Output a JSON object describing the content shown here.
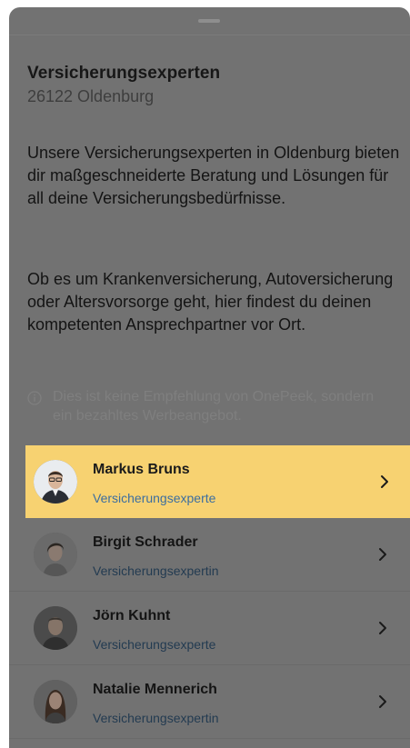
{
  "header": {
    "title": "Versicherungsexperten",
    "location": "26122 Oldenburg"
  },
  "intro": {
    "paragraph1": "Unsere Versicherungsexperten in Oldenburg bieten dir maßgeschneiderte Beratung und Lösungen für all deine Versicherungsbedürfnisse.",
    "paragraph2": "Ob es um Krankenversicherung, Autoversicherung oder Altersvorsorge geht, hier findest du deinen kompetenten Ansprechpartner vor Ort."
  },
  "disclaimer": {
    "icon": "info-icon",
    "text": "Dies ist keine Empfehlung von OnePeek, sondern ein bezahltes Werbeangebot."
  },
  "experts": [
    {
      "name": "Markus Bruns",
      "role": "Versicherungsexperte",
      "highlighted": true,
      "icon": "chevron-right-icon"
    },
    {
      "name": "Birgit Schrader",
      "role": "Versicherungsexpertin",
      "highlighted": false,
      "icon": "chevron-right-icon"
    },
    {
      "name": "Jörn Kuhnt",
      "role": "Versicherungsexperte",
      "highlighted": false,
      "icon": "chevron-right-icon"
    },
    {
      "name": "Natalie Mennerich",
      "role": "Versicherungsexpertin",
      "highlighted": false,
      "icon": "chevron-right-icon"
    }
  ],
  "colors": {
    "overlay": "#727272",
    "highlight": "#f7d271",
    "role_link": "#3c6ea0"
  }
}
